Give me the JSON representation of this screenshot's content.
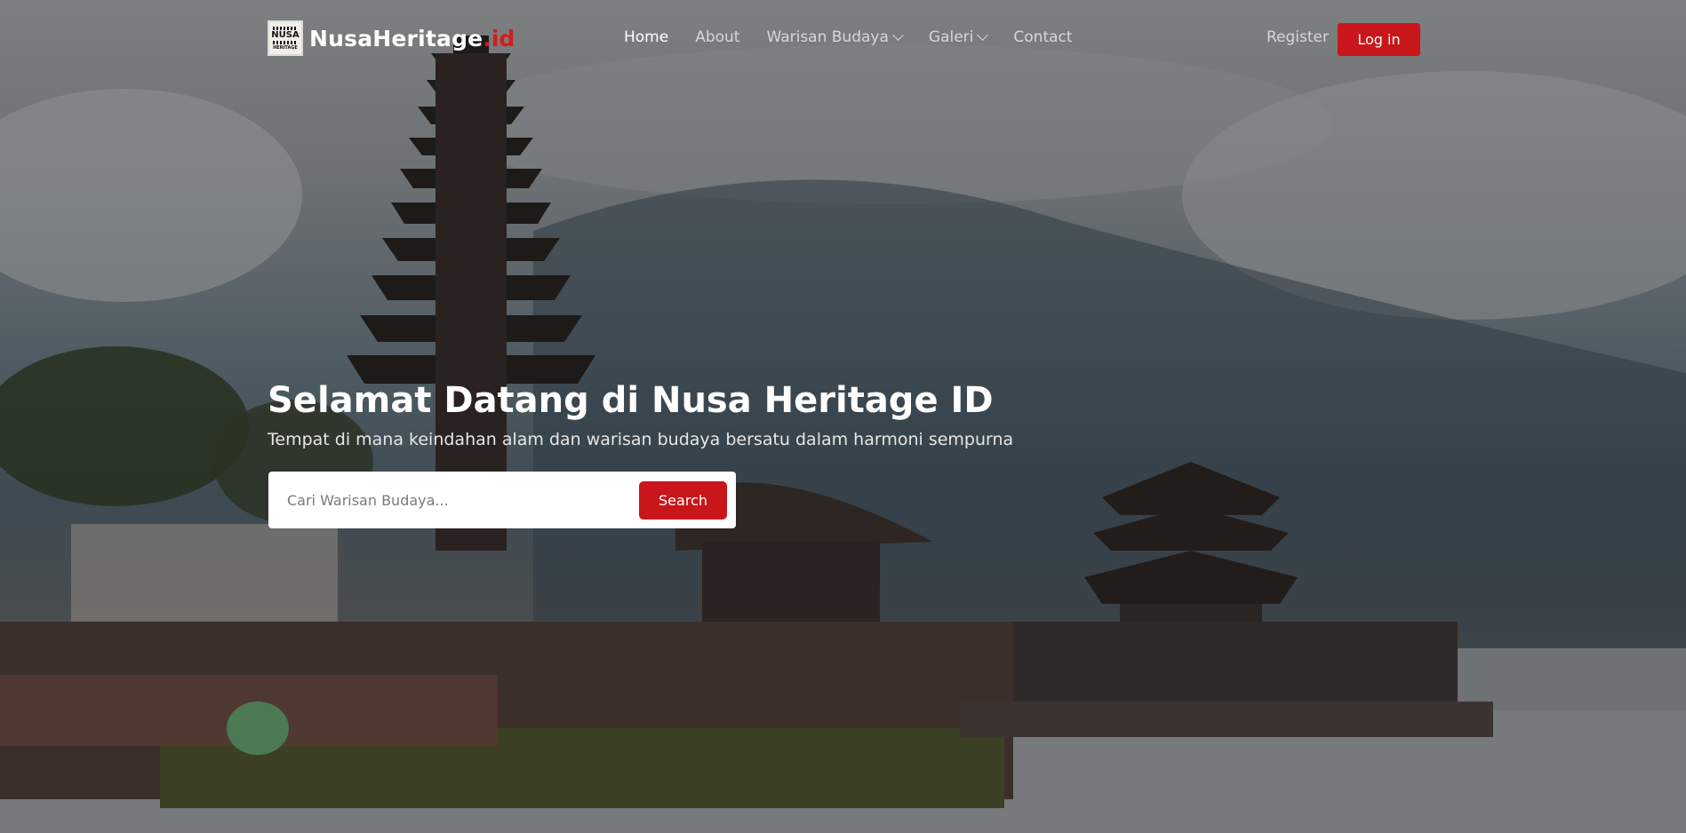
{
  "brand": {
    "logo_text": "NUSA",
    "logo_subtext": "HERITAGE",
    "name": "NusaHeritage",
    "tld": ".id"
  },
  "nav": {
    "items": [
      {
        "label": "Home",
        "active": true,
        "dropdown": false
      },
      {
        "label": "About",
        "active": false,
        "dropdown": false
      },
      {
        "label": "Warisan Budaya",
        "active": false,
        "dropdown": true
      },
      {
        "label": "Galeri",
        "active": false,
        "dropdown": true
      },
      {
        "label": "Contact",
        "active": false,
        "dropdown": false
      }
    ],
    "register_label": "Register",
    "login_label": "Log in"
  },
  "hero": {
    "title": "Selamat Datang di Nusa Heritage ID",
    "subtitle": "Tempat di mana keindahan alam dan warisan budaya bersatu dalam harmoni sempurna",
    "search_placeholder": "Cari Warisan Budaya...",
    "search_value": "",
    "search_button": "Search"
  },
  "colors": {
    "accent": "#c8161b",
    "tld": "#d51a1a"
  },
  "icons": {
    "dropdown": "chevron-down-icon"
  }
}
